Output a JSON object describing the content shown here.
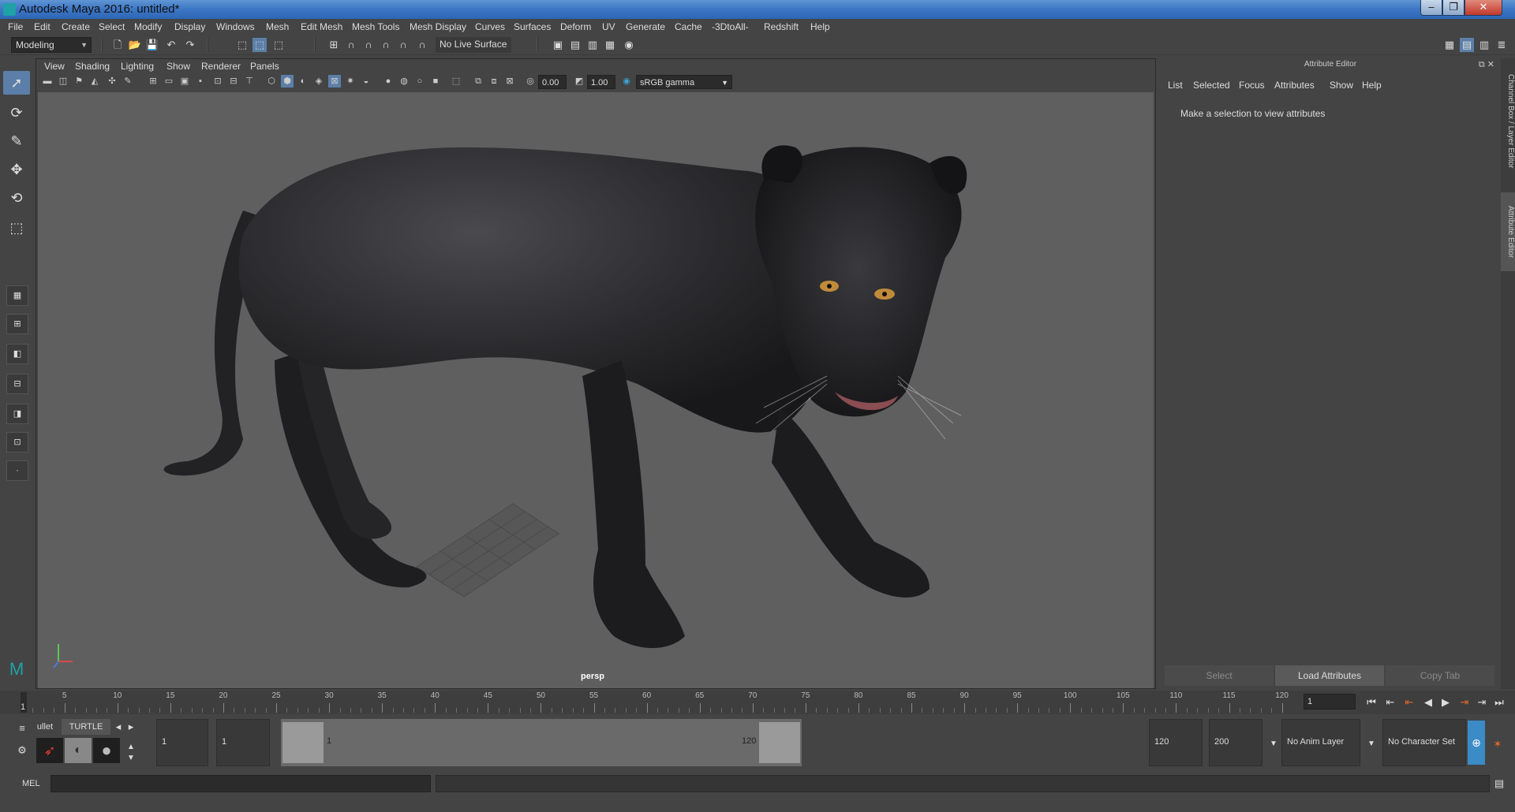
{
  "window": {
    "title": "Autodesk Maya 2016: untitled*",
    "min": "–",
    "max": "❐",
    "close": "✕"
  },
  "menu": [
    "File",
    "Edit",
    "Create",
    "Select",
    "Modify",
    "Display",
    "Windows",
    "Mesh",
    "Edit Mesh",
    "Mesh Tools",
    "Mesh Display",
    "Curves",
    "Surfaces",
    "Deform",
    "UV",
    "Generate",
    "Cache",
    "-3DtoAll-",
    "Redshift",
    "Help"
  ],
  "status": {
    "menu_set": "Modeling",
    "live_surface": "No Live Surface"
  },
  "panel": {
    "menu": [
      "View",
      "Shading",
      "Lighting",
      "Show",
      "Renderer",
      "Panels"
    ],
    "exposure": "0.00",
    "gamma": "1.00",
    "color_space": "sRGB gamma",
    "camera": "persp"
  },
  "attribute_editor": {
    "title": "Attribute Editor",
    "menu": [
      "List",
      "Selected",
      "Focus",
      "Attributes",
      "Show",
      "Help"
    ],
    "message": "Make a selection to view attributes",
    "buttons": {
      "select": "Select",
      "load": "Load Attributes",
      "copy": "Copy Tab"
    }
  },
  "side_tabs": {
    "channel_box": "Channel Box / Layer Editor",
    "attribute_editor": "Attribute Editor"
  },
  "timeline": {
    "tick_labels": [
      "5",
      "10",
      "15",
      "20",
      "25",
      "30",
      "35",
      "40",
      "45",
      "50",
      "55",
      "60",
      "65",
      "70",
      "75",
      "80",
      "85",
      "90",
      "95",
      "100",
      "105",
      "110",
      "115",
      "120"
    ],
    "start_marker": "1",
    "current_frame": "1"
  },
  "range": {
    "shelf_tab_left": "ullet",
    "shelf_tab_turtle": "TURTLE",
    "start": "1",
    "playback_start": "1",
    "range_start_label": "1",
    "range_end_label": "120",
    "playback_end": "120",
    "end": "200",
    "anim_layer": "No Anim Layer",
    "character_set": "No Character Set"
  },
  "cmdline": {
    "label": "MEL"
  }
}
